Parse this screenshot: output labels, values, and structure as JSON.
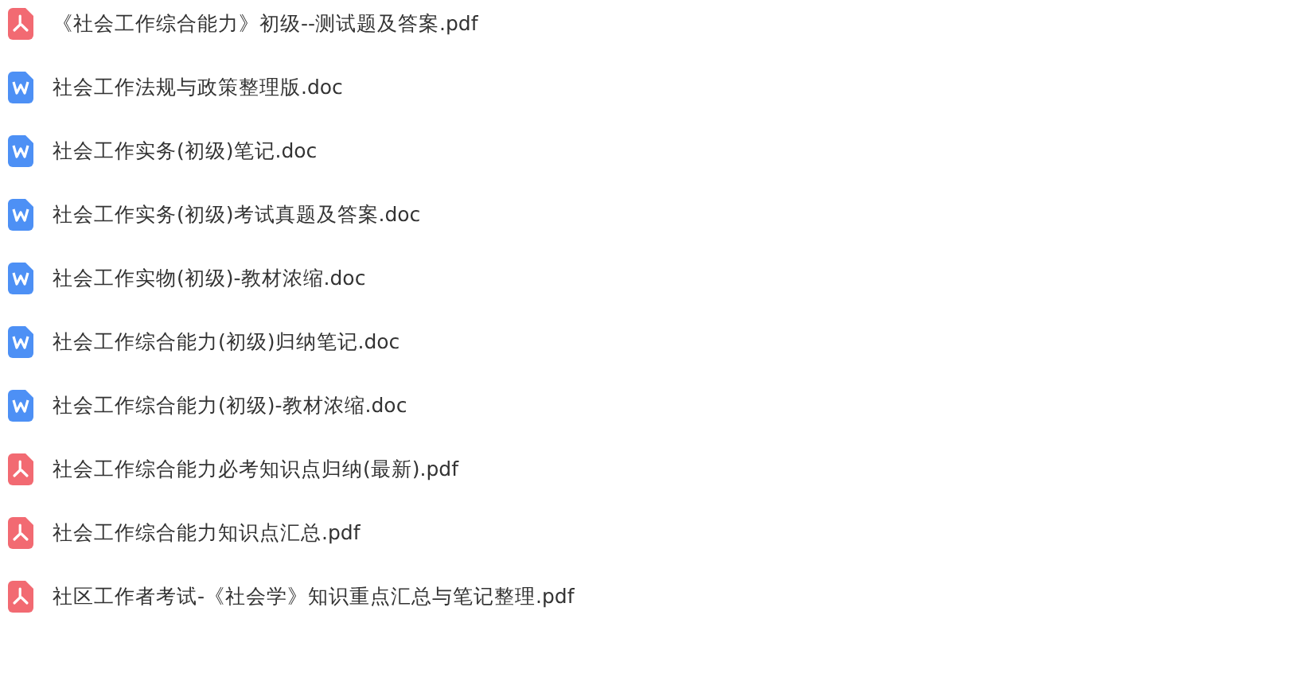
{
  "files": [
    {
      "kind": "pdf",
      "name": "《社会工作综合能力》初级--测试题及答案.pdf"
    },
    {
      "kind": "doc",
      "name": "社会工作法规与政策整理版.doc"
    },
    {
      "kind": "doc",
      "name": "社会工作实务(初级)笔记.doc"
    },
    {
      "kind": "doc",
      "name": "社会工作实务(初级)考试真题及答案.doc"
    },
    {
      "kind": "doc",
      "name": "社会工作实物(初级)-教材浓缩.doc"
    },
    {
      "kind": "doc",
      "name": "社会工作综合能力(初级)归纳笔记.doc"
    },
    {
      "kind": "doc",
      "name": "社会工作综合能力(初级)-教材浓缩.doc"
    },
    {
      "kind": "pdf",
      "name": "社会工作综合能力必考知识点归纳(最新).pdf"
    },
    {
      "kind": "pdf",
      "name": "社会工作综合能力知识点汇总.pdf"
    },
    {
      "kind": "pdf",
      "name": "社区工作者考试-《社会学》知识重点汇总与笔记整理.pdf"
    }
  ]
}
